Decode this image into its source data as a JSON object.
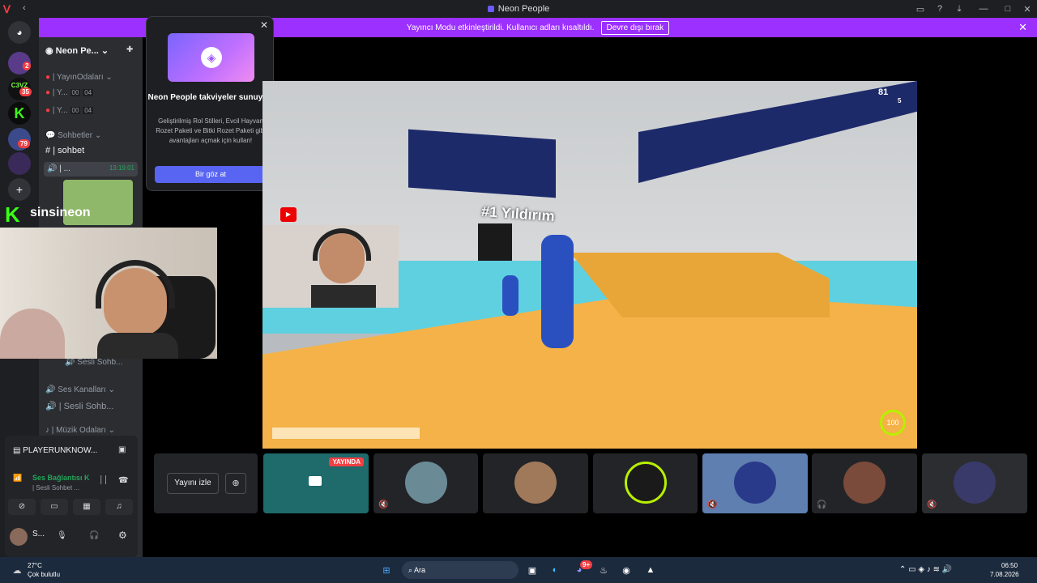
{
  "window": {
    "title": "Neon People"
  },
  "banner": {
    "text": "Yayıncı Modu etkinleştirildi. Kullanıcı adları kısaltıldı.",
    "button": "Devre dışı bırak"
  },
  "rail": {
    "badges": [
      "2",
      "35",
      "79"
    ],
    "rail_label": "C3VZ"
  },
  "server": {
    "name": "Neon Pe..."
  },
  "sidebar": {
    "cat1": "| YayınOdaları",
    "ch1": "| Y...",
    "ch1_a": "00",
    "ch1_b": "04",
    "ch2": "| Y...",
    "ch2_a": "00",
    "ch2_b": "04",
    "cat2": "Sohbetler",
    "ch3": "| sohbet",
    "ch4": "| ...",
    "ch4_time": "13:19:01",
    "ch5": "Sesli Sohb...",
    "cat3": "Ses Kanalları",
    "ch6": "| Sesli Sohb...",
    "cat4": "| Müzik Odaları"
  },
  "overlay": {
    "name": "sinsineon"
  },
  "popup": {
    "title": "Neon People takviyeler sunuyor!",
    "body": "Geliştirilmiş Rol Stilleri, Evcil Hayvan Rozet Paketi ve Bitki Rozet Paketi gibi avantajları açmak için kullan!",
    "cta": "Bir göz at"
  },
  "game": {
    "label": "#1 Yıldırım",
    "score": "81",
    "rank": "5",
    "timer": "100"
  },
  "tiles": {
    "watch": "Yayını izle",
    "live": "YAYINDA"
  },
  "voice": {
    "activity": "PLAYERUNKNOW...",
    "status": "Ses Bağlantısı K",
    "sub": "| Sesli Sohbet ...",
    "user": "S..."
  },
  "taskbar": {
    "temp": "27°C",
    "weather": "Çok bulutlu",
    "search": "Ara",
    "time": "06:50",
    "date": "7.08.2026",
    "discord_badge": "9+"
  },
  "colors": {
    "accent": "#9b30ff",
    "blurple": "#5865f2",
    "green": "#23a55a"
  }
}
